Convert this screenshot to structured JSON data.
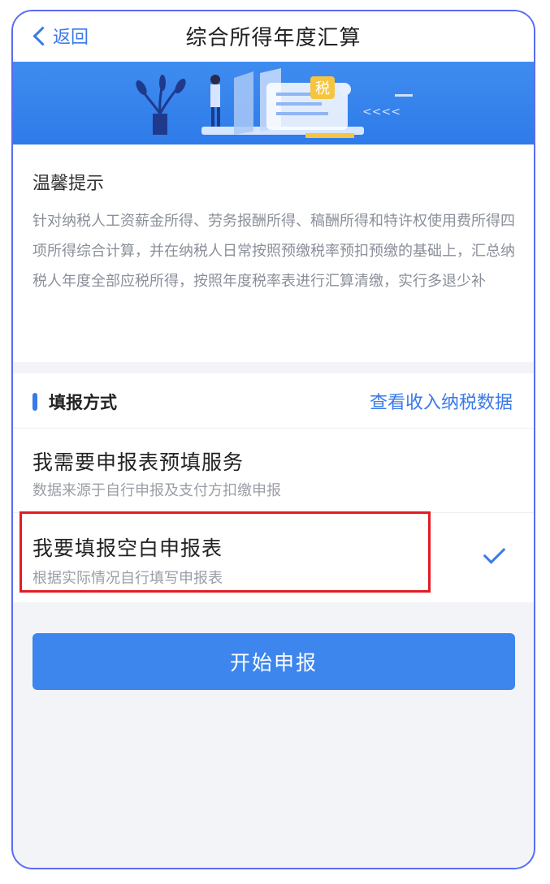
{
  "nav": {
    "back_label": "返回",
    "title": "综合所得年度汇算"
  },
  "banner": {
    "badge_text": "税",
    "arrows_text": "<<<<"
  },
  "tips": {
    "title": "温馨提示",
    "body": "针对纳税人工资薪金所得、劳务报酬所得、稿酬所得和特许权使用费所得四项所得综合计算，并在纳税人日常按照预缴税率预扣预缴的基础上，汇总纳税人年度全部应税所得，按照年度税率表进行汇算清缴，实行多退少补"
  },
  "method": {
    "label": "填报方式",
    "view_link": "查看收入纳税数据"
  },
  "options": [
    {
      "title": "我需要申报表预填服务",
      "subtitle": "数据来源于自行申报及支付方扣缴申报",
      "selected": false
    },
    {
      "title": "我要填报空白申报表",
      "subtitle": "根据实际情况自行填写申报表",
      "selected": true
    }
  ],
  "start_button": "开始申报",
  "colors": {
    "accent": "#3a7ae8",
    "highlight": "#e21c24",
    "frame": "#5a6cf0"
  }
}
